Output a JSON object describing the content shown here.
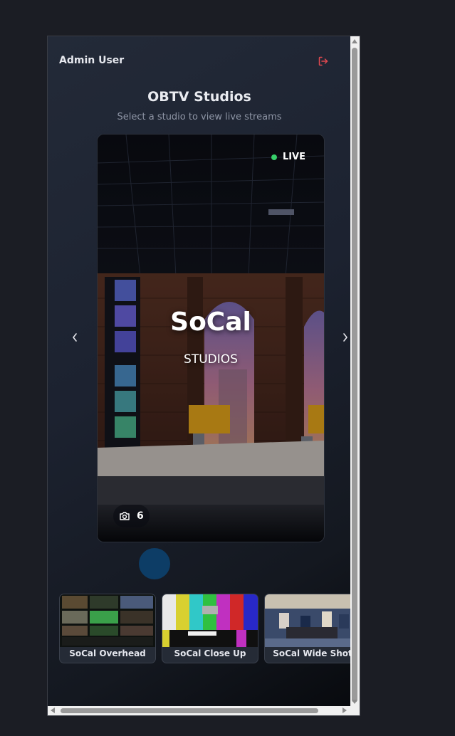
{
  "header": {
    "user_name": "Admin User",
    "logout_icon": "logout-icon",
    "logout_color": "#e0484f"
  },
  "page": {
    "title": "OBTV Studios",
    "subtitle": "Select a studio to view live streams"
  },
  "carousel": {
    "prev_icon": "chevron-left-icon",
    "next_icon": "chevron-right-icon",
    "studio": {
      "name": "SoCal",
      "type": "STUDIOS",
      "status": "LIVE",
      "status_color": "#37d06a",
      "camera_icon": "camera-icon",
      "camera_count": "6"
    }
  },
  "cameras": [
    {
      "label": "SoCal Overhead"
    },
    {
      "label": "SoCal Close Up"
    },
    {
      "label": "SoCal Wide Shot"
    }
  ],
  "colors": {
    "background": "#1b1d24",
    "panel": "#1c2230",
    "accent_dot": "#0d3d66"
  }
}
